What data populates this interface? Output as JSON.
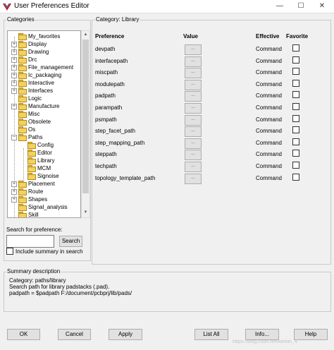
{
  "window": {
    "title": "User Preferences Editor",
    "minimize_glyph": "—",
    "maximize_glyph": "☐",
    "close_glyph": "✕"
  },
  "categories": {
    "label": "Categories",
    "items": [
      {
        "label": "My_favorites",
        "expander": ""
      },
      {
        "label": "Display",
        "expander": "+"
      },
      {
        "label": "Drawing",
        "expander": "+"
      },
      {
        "label": "Drc",
        "expander": "+"
      },
      {
        "label": "File_management",
        "expander": "+"
      },
      {
        "label": "Ic_packaging",
        "expander": "+"
      },
      {
        "label": "Interactive",
        "expander": "+"
      },
      {
        "label": "Interfaces",
        "expander": "+"
      },
      {
        "label": "Logic",
        "expander": ""
      },
      {
        "label": "Manufacture",
        "expander": "+"
      },
      {
        "label": "Misc",
        "expander": ""
      },
      {
        "label": "Obsolete",
        "expander": ""
      },
      {
        "label": "Os",
        "expander": ""
      },
      {
        "label": "Paths",
        "expander": "−"
      },
      {
        "label": "Config",
        "expander": ""
      },
      {
        "label": "Editor",
        "expander": ""
      },
      {
        "label": "Library",
        "expander": ""
      },
      {
        "label": "MCM",
        "expander": ""
      },
      {
        "label": "Signoise",
        "expander": ""
      },
      {
        "label": "Placement",
        "expander": "+"
      },
      {
        "label": "Route",
        "expander": "+"
      },
      {
        "label": "Shapes",
        "expander": "+"
      },
      {
        "label": "Signal_analysis",
        "expander": ""
      },
      {
        "label": "Skill",
        "expander": ""
      }
    ]
  },
  "search": {
    "label": "Search for preference:",
    "value": "",
    "button": "Search",
    "include_summary_label": "Include summary in search",
    "include_summary_checked": false
  },
  "category_panel": {
    "label": "Category:  Library",
    "columns": {
      "preference": "Preference",
      "value": "Value",
      "effective": "Effective",
      "favorite": "Favorite"
    },
    "value_button_label": "...",
    "rows": [
      {
        "name": "devpath",
        "effective": "Command"
      },
      {
        "name": "interfacepath",
        "effective": "Command"
      },
      {
        "name": "miscpath",
        "effective": "Command"
      },
      {
        "name": "modulepath",
        "effective": "Command"
      },
      {
        "name": "padpath",
        "effective": "Command"
      },
      {
        "name": "parampath",
        "effective": "Command"
      },
      {
        "name": "psmpath",
        "effective": "Command"
      },
      {
        "name": "step_facet_path",
        "effective": "Command"
      },
      {
        "name": "step_mapping_path",
        "effective": "Command"
      },
      {
        "name": "steppath",
        "effective": "Command"
      },
      {
        "name": "techpath",
        "effective": "Command"
      },
      {
        "name": "topology_template_path",
        "effective": "Command"
      }
    ]
  },
  "summary": {
    "label": "Summary description",
    "lines": [
      "Category: paths/library",
      "Search path for library padstacks (.pad).",
      "padpath = $padpath F:/document/pcbprj/lib/pads/"
    ]
  },
  "buttons": {
    "ok": "OK",
    "cancel": "Cancel",
    "apply": "Apply",
    "list_all": "List All",
    "info": "Info...",
    "help": "Help"
  },
  "watermark": "https://blog.csdn.net/weixin_4"
}
